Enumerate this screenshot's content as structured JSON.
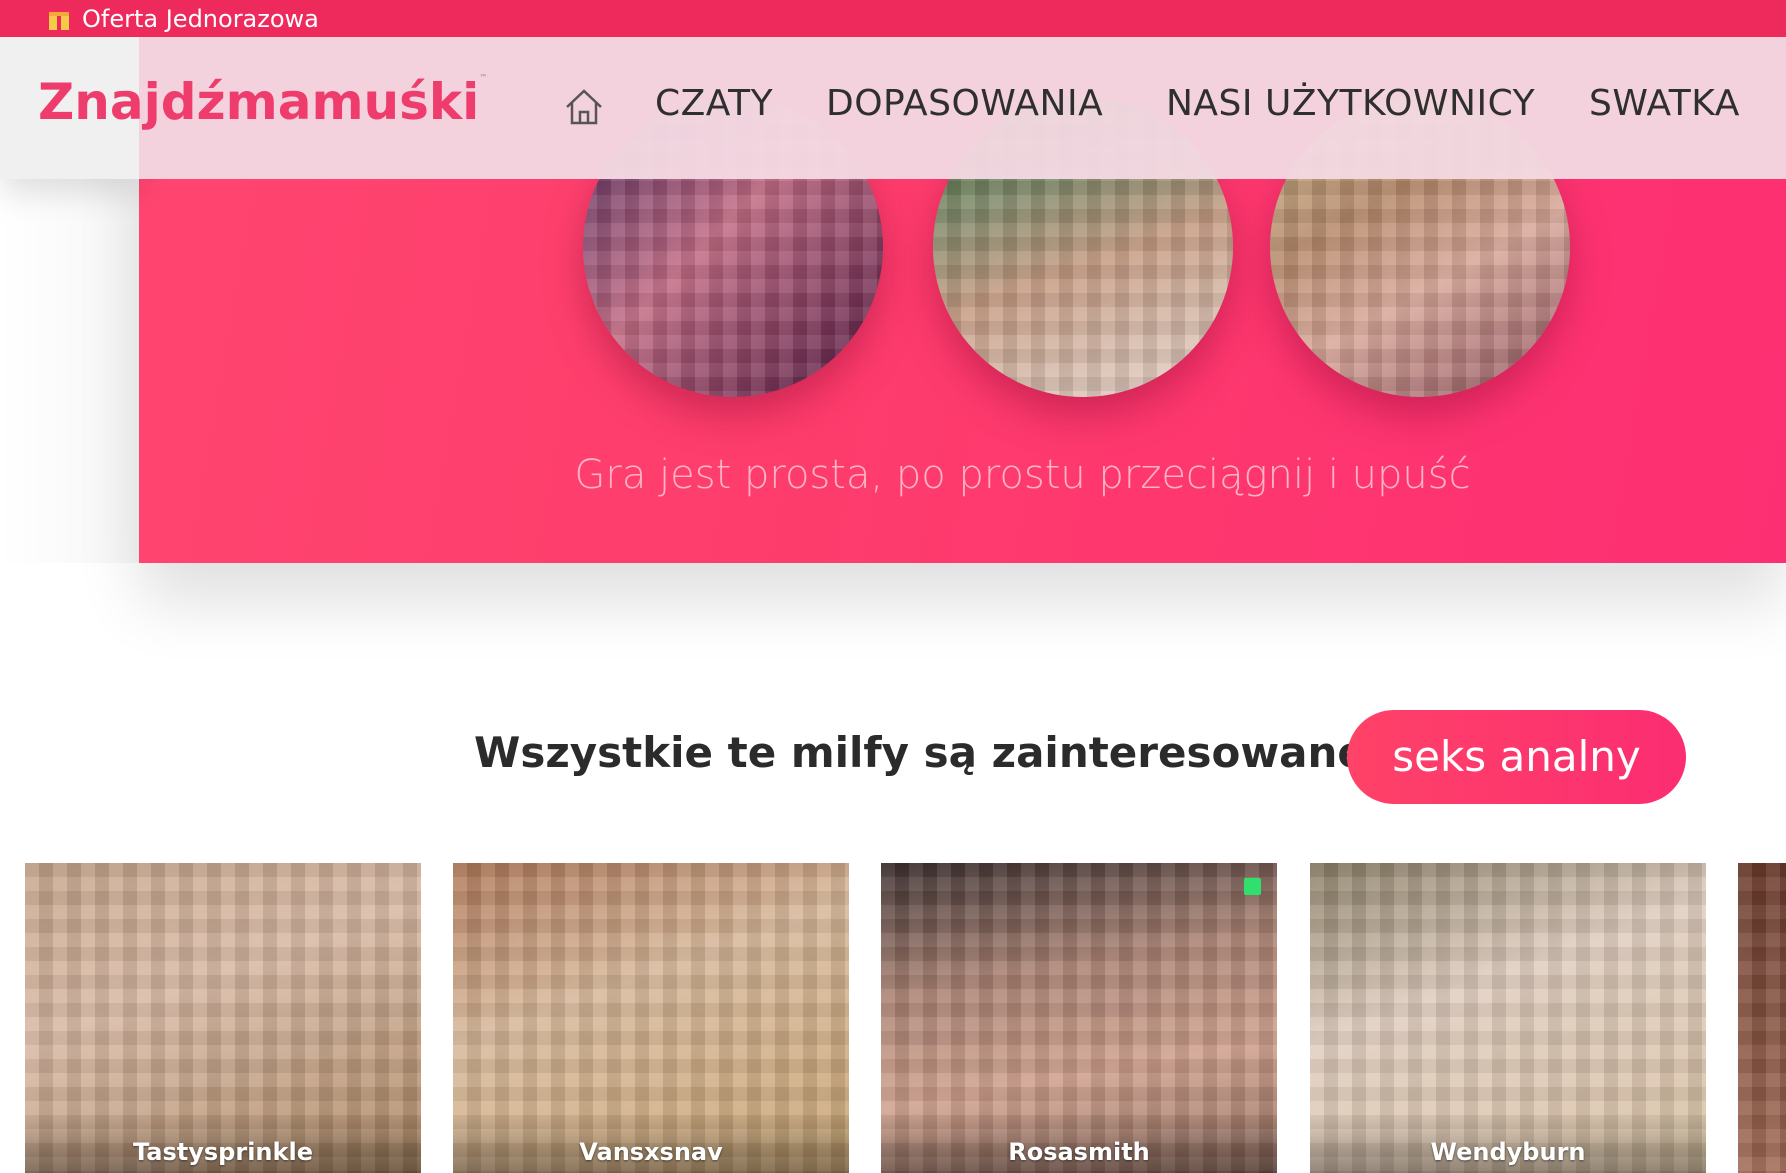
{
  "promo": {
    "text": "Oferta Jednorazowa",
    "icon": "gift-icon"
  },
  "nav": {
    "logo": "Znajdźmamuśki",
    "items": [
      {
        "label": "CZATY"
      },
      {
        "label": "DOPASOWANIA"
      },
      {
        "label": "NASI UŻYTKOWNICY"
      },
      {
        "label": "SWATKA"
      }
    ],
    "home_icon": "home-icon"
  },
  "hero": {
    "caption": "Gra jest prosta, po prostu przeciągnij i upuść"
  },
  "section": {
    "heading": "Wszystkie te milfy są zainteresowane",
    "pill": "seks analny"
  },
  "cards": [
    {
      "name": "Tastysprinkle",
      "online": false
    },
    {
      "name": "Vansxsnav",
      "online": false
    },
    {
      "name": "Rosasmith",
      "online": true
    },
    {
      "name": "Wendyburn",
      "online": false
    }
  ],
  "colors": {
    "brand": "#ee3c6d",
    "promo_bar": "#ee2a5d",
    "online": "#2fe06f"
  }
}
